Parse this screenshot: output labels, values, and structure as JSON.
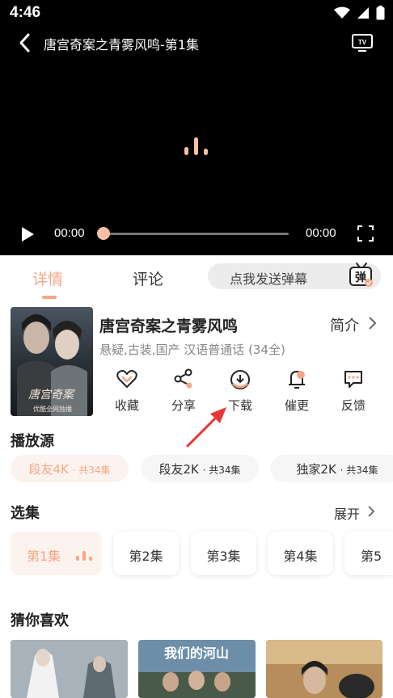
{
  "status_bar": {
    "time": "4:46"
  },
  "player": {
    "title": "唐宫奇案之青雾风鸣-第1集",
    "current_time": "00:00",
    "total_time": "00:00",
    "progress": 0
  },
  "tabs": {
    "detail": "详情",
    "comment": "评论",
    "active": "详情"
  },
  "danmu": {
    "placeholder": "点我发送弹幕",
    "icon_text": "弹"
  },
  "show": {
    "title": "唐宫奇案之青雾风鸣",
    "intro_label": "简介",
    "meta": "悬疑,古装,国产 汉语普通话 (34全)",
    "poster_title": "唐宫奇案",
    "poster_sub": "优酷全网独播"
  },
  "actions": [
    {
      "label": "收藏",
      "icon": "heart-icon"
    },
    {
      "label": "分享",
      "icon": "share-icon"
    },
    {
      "label": "下载",
      "icon": "download-icon"
    },
    {
      "label": "催更",
      "icon": "bell-icon"
    },
    {
      "label": "反馈",
      "icon": "feedback-icon"
    }
  ],
  "sources": {
    "title": "播放源",
    "items": [
      {
        "name": "段友4K",
        "count": "· 共34集",
        "active": true
      },
      {
        "name": "段友2K",
        "count": "· 共34集",
        "active": false
      },
      {
        "name": "独家2K",
        "count": "· 共34集",
        "active": false
      }
    ]
  },
  "episodes": {
    "title": "选集",
    "expand_label": "展开",
    "items": [
      "第1集",
      "第2集",
      "第3集",
      "第4集",
      "第5"
    ],
    "active_index": 0
  },
  "recommend": {
    "title": "猜你喜欢",
    "item2_text": "我们的河山"
  },
  "colors": {
    "accent": "#f4a786",
    "accent_bg": "#fdf3ee",
    "player_bg": "#000000"
  }
}
